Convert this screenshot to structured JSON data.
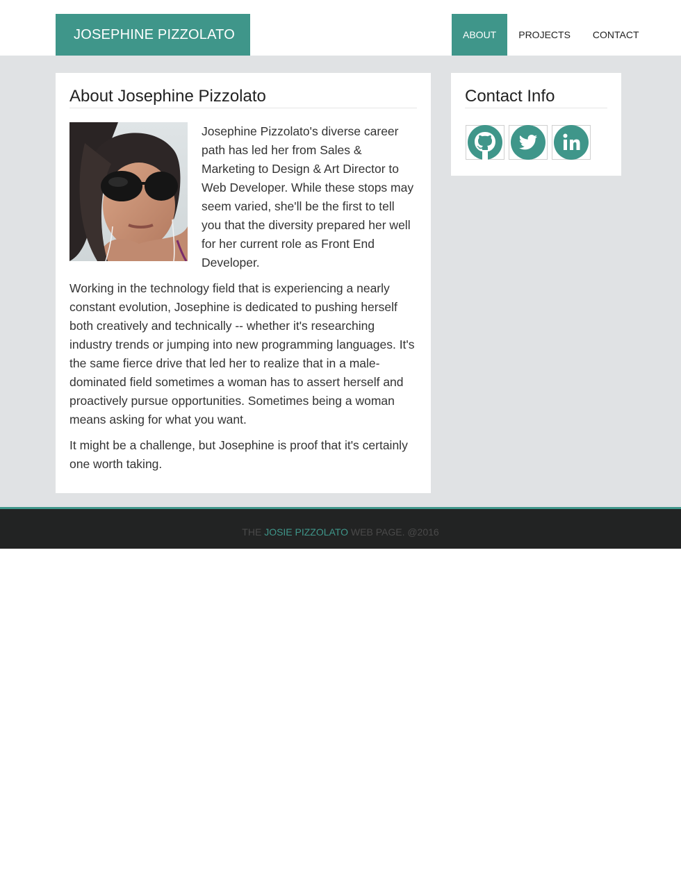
{
  "header": {
    "brand": "JOSEPHINE PIZZOLATO",
    "nav": [
      {
        "label": "ABOUT",
        "active": true
      },
      {
        "label": "PROJECTS",
        "active": false
      },
      {
        "label": "CONTACT",
        "active": false
      }
    ]
  },
  "about": {
    "title": "About Josephine Pizzolato",
    "photo_alt": "selfie-photo",
    "paragraphs": [
      "Josephine Pizzolato's diverse career path has led her from Sales & Marketing to Design & Art Director to Web Developer. While these stops may seem varied, she'll be the first to tell you that the diversity prepared her well for her current role as Front End Developer.",
      "Working in the technology field that is experiencing a nearly constant evolution, Josephine is dedicated to pushing herself both creatively and technically -- whether it's researching industry trends or jumping into new programming languages. It's the same fierce drive that led her to realize that in a male-dominated field sometimes a woman has to assert herself and proactively pursue opportunities. Sometimes being a woman means asking for what you want.",
      "It might be a challenge, but Josephine is proof that it's certainly one worth taking."
    ]
  },
  "contact": {
    "title": "Contact Info",
    "links": [
      {
        "icon": "github-icon"
      },
      {
        "icon": "twitter-icon"
      },
      {
        "icon": "linkedin-icon"
      }
    ]
  },
  "footer": {
    "prefix": "THE",
    "name": "JOSIE PIZZOLATO",
    "suffix": "WEB PAGE. @2016"
  },
  "colors": {
    "accent": "#3f968a",
    "page_background": "#e0e2e4",
    "footer_background": "#222323"
  }
}
